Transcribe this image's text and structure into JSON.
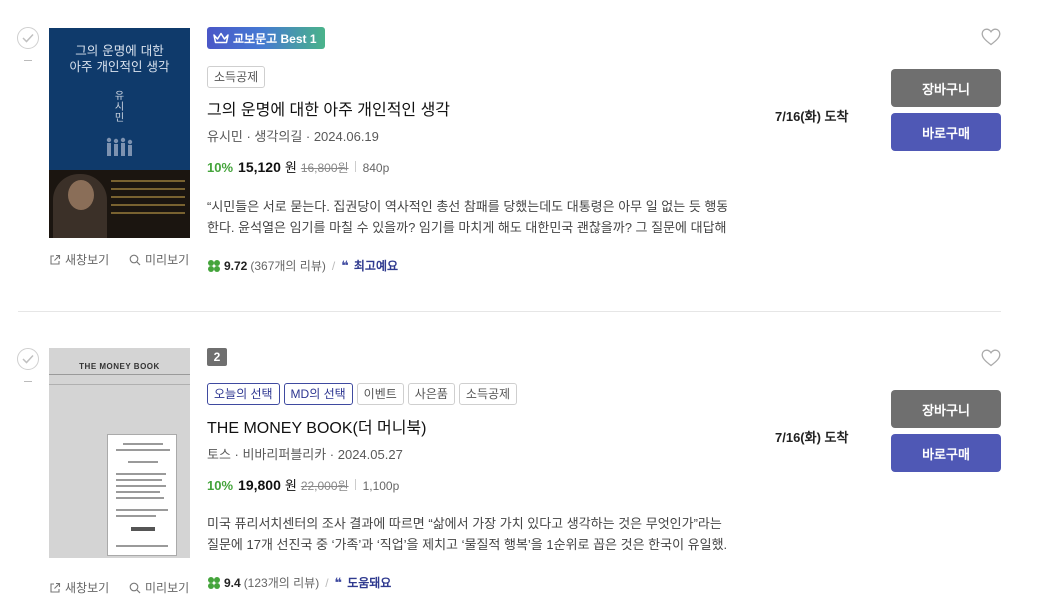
{
  "sub_buttons": {
    "new_window": "새창보기",
    "preview": "미리보기"
  },
  "actions": {
    "cart": "장바구니",
    "buy": "바로구매"
  },
  "colors": {
    "discount": "#44a43b",
    "buy_button": "#4f58b5",
    "cart_button": "#6f6f6f",
    "review_accent": "#3f4aa0"
  },
  "items": [
    {
      "badge": "교보문고 Best 1",
      "tags": [
        "소득공제"
      ],
      "title": "그의 운명에 대한 아주 개인적인 생각",
      "meta": "유시민 · 생각의길 · 2024.06.19",
      "discount": "10%",
      "sale_price": "15,120",
      "won": "원",
      "original_price": "16,800원",
      "pages": "840p",
      "description": [
        "“시민들은 서로 묻는다. 집권당이 역사적인 총선 참패를 당했는데도 대통령은 아무 일 없는 듯 행동",
        "한다. 윤석열은 임기를 마칠 수 있을까? 임기를 마치게 해도 대한민국 괜찮을까? 그 질문에 대답해..."
      ],
      "rating": "9.72",
      "review_count": "(367개의 리뷰)",
      "review_keyword": "최고예요",
      "delivery": "7/16(화) 도착",
      "cover": {
        "title_line1": "그의 운명에 대한",
        "title_line2": "아주 개인적인 생각",
        "author_vertical": [
          "유",
          "시",
          "민"
        ]
      }
    },
    {
      "rank": "2",
      "tags": [
        "오늘의 선택",
        "MD의 선택",
        "이벤트",
        "사은품",
        "소득공제"
      ],
      "title": "THE MONEY BOOK(더 머니북)",
      "meta": "토스 · 비바리퍼블리카 · 2024.05.27",
      "discount": "10%",
      "sale_price": "19,800",
      "won": "원",
      "original_price": "22,000원",
      "pages": "1,100p",
      "description": [
        "미국 퓨리서치센터의 조사 결과에 따르면 “삶에서 가장 가치 있다고 생각하는 것은 무엇인가”라는",
        "질문에 17개 선진국 중 ‘가족’과 ‘직업’을 제치고 ‘물질적 행복’을 1순위로 꼽은 것은 한국이 유일했..."
      ],
      "rating": "9.4",
      "review_count": "(123개의 리뷰)",
      "review_keyword": "도움돼요",
      "delivery": "7/16(화) 도착",
      "cover": {
        "title": "THE MONEY BOOK"
      }
    }
  ]
}
